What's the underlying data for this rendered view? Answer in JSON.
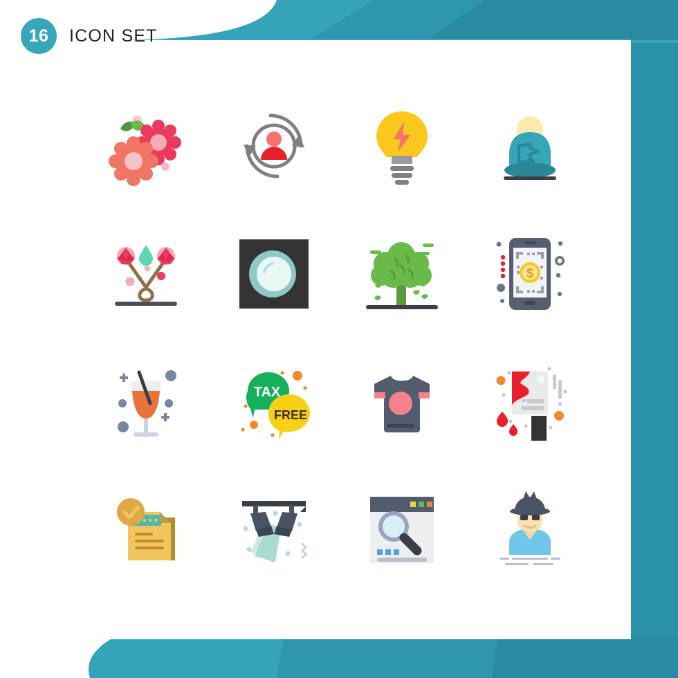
{
  "header": {
    "count": "16",
    "title": "Icon Set",
    "badge_color": "#39a5bd"
  },
  "theme": {
    "banner_light": "#35a3b8",
    "banner_mid": "#2f97ac",
    "banner_dark": "#2a8ba0",
    "page_background": "#ffffff"
  },
  "grid": {
    "columns": 4,
    "rows": 4,
    "icons": [
      {
        "name": "flowers-blossom-icon",
        "label": "Flowers"
      },
      {
        "name": "user-refresh-cycle-icon",
        "label": "User Refresh"
      },
      {
        "name": "lightbulb-energy-icon",
        "label": "Energy Idea"
      },
      {
        "name": "person-meditation-icon",
        "label": "Meditation"
      },
      {
        "name": "spa-crossed-flowers-icon",
        "label": "Spa Flowers"
      },
      {
        "name": "camera-lens-icon",
        "label": "Camera Lens"
      },
      {
        "name": "tree-leaves-icon",
        "label": "Tree"
      },
      {
        "name": "mobile-payment-scan-icon",
        "label": "Mobile Payment"
      },
      {
        "name": "cocktail-glass-icon",
        "label": "Cocktail"
      },
      {
        "name": "tax-free-bubbles-icon",
        "label": "Tax Free"
      },
      {
        "name": "tshirt-icon",
        "label": "T-Shirt"
      },
      {
        "name": "poster-paint-icon",
        "label": "Poster Paint"
      },
      {
        "name": "approved-document-icon",
        "label": "Approved Document"
      },
      {
        "name": "stage-spotlights-icon",
        "label": "Stage Lights"
      },
      {
        "name": "browser-search-icon",
        "label": "Web Search"
      },
      {
        "name": "spy-detective-icon",
        "label": "Spy"
      }
    ],
    "bubble_text": {
      "tax": "TAX",
      "free": "FREE"
    }
  }
}
